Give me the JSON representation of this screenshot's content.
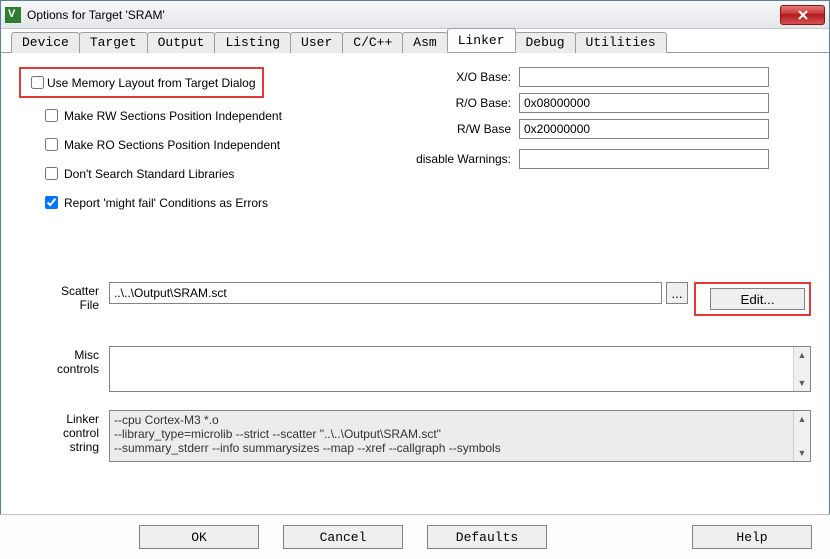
{
  "titlebar": {
    "title": "Options for Target 'SRAM'"
  },
  "tabs": [
    {
      "label": "Device"
    },
    {
      "label": "Target"
    },
    {
      "label": "Output"
    },
    {
      "label": "Listing"
    },
    {
      "label": "User"
    },
    {
      "label": "C/C++"
    },
    {
      "label": "Asm"
    },
    {
      "label": "Linker"
    },
    {
      "label": "Debug"
    },
    {
      "label": "Utilities"
    }
  ],
  "active_tab": "Linker",
  "linker": {
    "use_memory_layout_label": "Use Memory Layout from Target Dialog",
    "make_rw_label": "Make RW Sections Position Independent",
    "make_ro_label": "Make RO Sections Position Independent",
    "dont_search_label": "Don't Search Standard Libraries",
    "report_might_fail_label": "Report 'might fail' Conditions as Errors",
    "report_might_fail_checked": true,
    "xo_base_label": "X/O Base:",
    "xo_base_value": "",
    "ro_base_label": "R/O Base:",
    "ro_base_value": "0x08000000",
    "rw_base_label": "R/W Base",
    "rw_base_value": "0x20000000",
    "disable_warnings_label": "disable Warnings:",
    "disable_warnings_value": "",
    "scatter_label": "Scatter\nFile",
    "scatter_value": "..\\..\\Output\\SRAM.sct",
    "browse_label": "...",
    "edit_label": "Edit...",
    "misc_label": "Misc\ncontrols",
    "misc_value": "",
    "linker_ctrl_label": "Linker\ncontrol\nstring",
    "linker_ctrl_value": "--cpu Cortex-M3 *.o\n--library_type=microlib --strict --scatter \"..\\..\\Output\\SRAM.sct\"\n--summary_stderr --info summarysizes --map --xref --callgraph --symbols"
  },
  "buttons": {
    "ok": "OK",
    "cancel": "Cancel",
    "defaults": "Defaults",
    "help": "Help"
  }
}
